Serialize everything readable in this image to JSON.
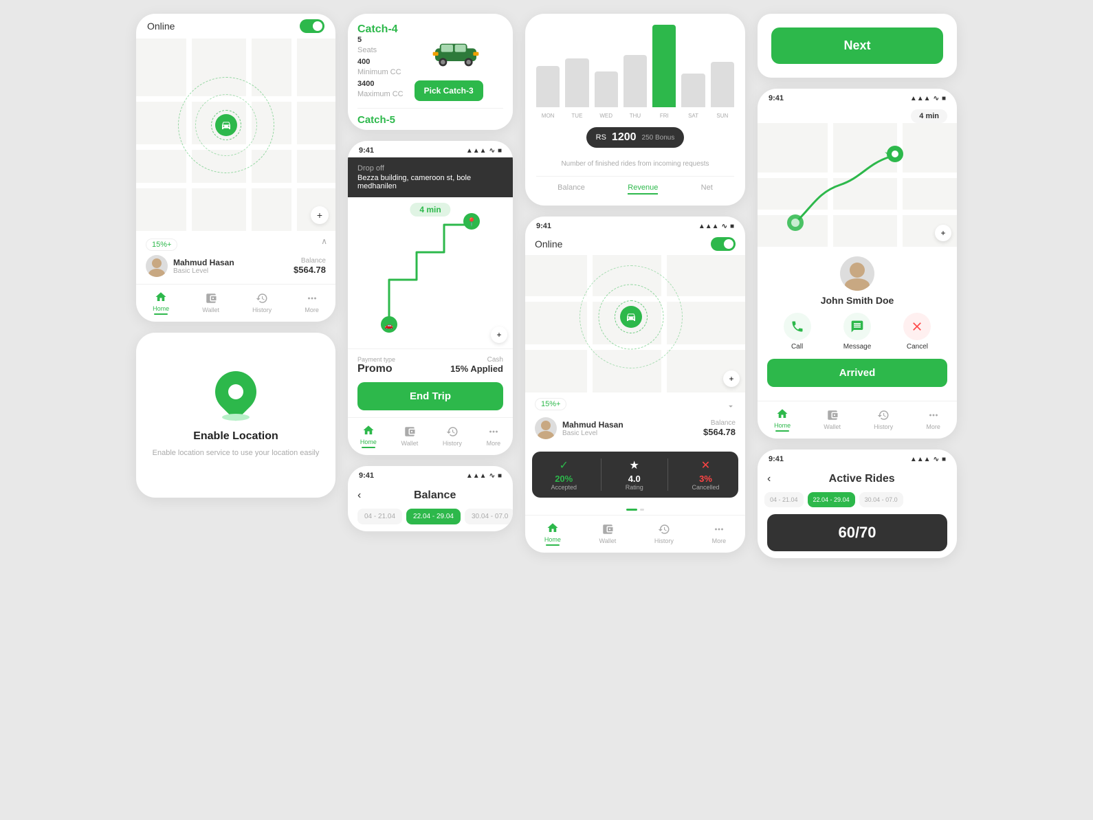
{
  "colors": {
    "green": "#2db84b",
    "dark": "#333",
    "light_bg": "#f5f5f5",
    "white": "#ffffff",
    "gray": "#aaaaaa",
    "red": "#ff4444"
  },
  "col1": {
    "card_online": {
      "status": "Online",
      "toggle": true,
      "percentage": "15%+",
      "user_name": "Mahmud Hasan",
      "user_level": "Basic Level",
      "balance_label": "Balance",
      "balance_value": "$564.78"
    },
    "card_location": {
      "title": "Enable Location",
      "description": "Enable location service to use your location easily"
    },
    "nav": {
      "items": [
        "Home",
        "Wallet",
        "History",
        "More"
      ]
    }
  },
  "col2": {
    "card_catch": {
      "catch4": {
        "name": "Catch-4",
        "seats_label": "Seats",
        "seats": "5",
        "min_cc_label": "Minimum CC",
        "min_cc": "400",
        "max_cc_label": "Maximum CC",
        "max_cc": "3400",
        "btn": "Pick Catch-3"
      },
      "catch5": {
        "name": "Catch-5"
      }
    },
    "card_trip": {
      "time": "9:41",
      "drop_off_label": "Drop off",
      "drop_off_address": "Bezza building, cameroon st, bole medhanilen",
      "timer": "4 min",
      "payment_type_label": "Payment type",
      "payment_type": "Promo",
      "cash_label": "Cash",
      "applied": "15% Applied",
      "end_btn": "End Trip"
    },
    "card_balance": {
      "time": "9:41",
      "back": "‹",
      "title": "Balance",
      "dates": [
        "04 - 21.04",
        "22.04 - 29.04",
        "30.04 - 07.0"
      ]
    },
    "nav": {
      "items": [
        "Home",
        "Wallet",
        "History",
        "More"
      ]
    }
  },
  "col3": {
    "card_stats": {
      "days": [
        "MON",
        "TUE",
        "WED",
        "THU",
        "FRI",
        "SAT",
        "SUN"
      ],
      "bars": [
        55,
        65,
        48,
        70,
        110,
        45,
        60
      ],
      "active_day": 4,
      "earnings": "1200",
      "bonus": "250",
      "bonus_label": "Bonus",
      "description": "Number of finished rides from incoming requests",
      "tabs": [
        "Balance",
        "Revenue",
        "Net"
      ],
      "active_tab": 1
    },
    "card_online2": {
      "time": "9:41",
      "status": "Online",
      "toggle": true,
      "percentage": "15%+",
      "user_name": "Mahmud Hasan",
      "user_level": "Basic Level",
      "balance_label": "Balance",
      "balance_value": "$564.78",
      "stats": [
        {
          "icon": "✓",
          "value": "20%",
          "label": "Accepted",
          "color": "green"
        },
        {
          "icon": "★",
          "value": "4.0",
          "label": "Rating",
          "color": "white"
        },
        {
          "icon": "✕",
          "value": "3%",
          "label": "Cancelled",
          "color": "red"
        }
      ]
    },
    "nav": {
      "items": [
        "Home",
        "Wallet",
        "History",
        "More"
      ]
    }
  },
  "col4": {
    "card_next": {
      "btn_label": "Next"
    },
    "card_trip_right": {
      "time": "9:41",
      "timer": "4 min",
      "driver_name": "John Smith Doe",
      "actions": [
        "Call",
        "Message",
        "Cancel"
      ],
      "arrived_btn": "Arrived"
    },
    "card_rides": {
      "time": "9:41",
      "back": "‹",
      "title": "Active Rides",
      "dates": [
        "04 - 21.04",
        "22.04 - 29.04",
        "30.04 - 07.0"
      ],
      "score": "60/70"
    },
    "nav": {
      "items": [
        "Home",
        "Wallet",
        "History",
        "More"
      ]
    }
  }
}
